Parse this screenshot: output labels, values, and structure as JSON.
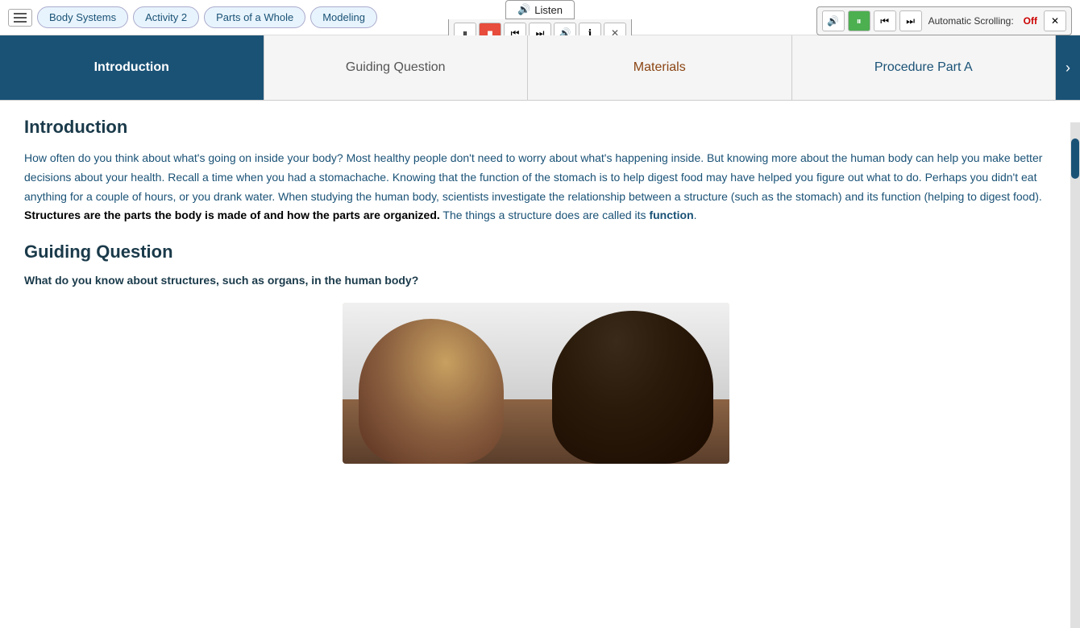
{
  "topnav": {
    "tabs": [
      {
        "label": "Body Systems",
        "id": "body-systems"
      },
      {
        "label": "Activity 2",
        "id": "activity-2"
      },
      {
        "label": "Parts of a Whole",
        "id": "parts-of-whole"
      },
      {
        "label": "Modeling",
        "id": "modeling"
      }
    ]
  },
  "listen_toolbar": {
    "listen_label": "Listen",
    "pause_icon": "⏸",
    "stop_icon": "■",
    "back_icon": "⏮",
    "forward_icon": "⏭",
    "volume_icon": "🔊",
    "info_icon": "ℹ",
    "close_icon": "✕"
  },
  "right_toolbar": {
    "volume_icon": "🔊",
    "pause_icon": "⏸",
    "back_icon": "⏮",
    "forward_icon": "⏭",
    "auto_scroll_label": "Automatic Scrolling:",
    "auto_scroll_value": "Off",
    "close_icon": "✕"
  },
  "tabs": {
    "items": [
      {
        "label": "Introduction",
        "active": true,
        "id": "intro-tab"
      },
      {
        "label": "Guiding Question",
        "active": false,
        "id": "guiding-tab"
      },
      {
        "label": "Materials",
        "active": false,
        "id": "materials-tab"
      },
      {
        "label": "Procedure Part A",
        "active": false,
        "id": "procedure-tab"
      }
    ],
    "next_icon": "›"
  },
  "content": {
    "intro_title": "Introduction",
    "intro_paragraph": "How often do you think about what's going on inside your body? Most healthy people don't need to worry about what's happening inside. But knowing more about the human body can help you make better decisions about your health. Recall a time when you had a stomachache. Knowing that the function of the stomach is to help digest food may have helped you figure out what to do. Perhaps you didn't eat anything for a couple of hours, or you drank water. When studying the human body, scientists investigate the relationship between a structure (such as the stomach) and its function (helping to digest food). ",
    "intro_bold": "Structures are the parts the body is made of and how the parts are organized.",
    "intro_suffix": " The things a structure does are called its ",
    "intro_function_bold": "function",
    "intro_end": ".",
    "guiding_title": "Guiding Question",
    "guiding_question": "What do you know about structures, such as organs, in the human body?"
  }
}
